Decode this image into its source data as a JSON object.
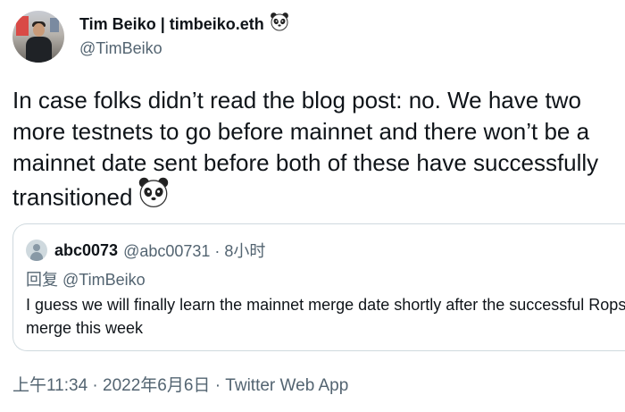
{
  "author": {
    "display_name": "Tim Beiko | timbeiko.eth",
    "name_emoji": "panda-emoji",
    "handle": "@TimBeiko"
  },
  "tweet": {
    "text": "In case folks didn’t read the blog post: no. We have two more testnets to go before mainnet and there won’t be a mainnet date sent before both of these have successfully transitioned",
    "trailing_emoji": "panda-emoji"
  },
  "quote": {
    "name": "abc0073",
    "handle_time": "@abc00731 · 8小时",
    "reply_prefix": "回复",
    "reply_to": "@TimBeiko",
    "text": "I guess we will finally learn the mainnet merge date shortly after the successful Ropsten merge this week"
  },
  "footer": {
    "meta": "上午11:34 · 2022年6月6日 · Twitter Web App"
  },
  "colors": {
    "text": "#0f1419",
    "secondary": "#536471",
    "border": "#cfd9de"
  }
}
